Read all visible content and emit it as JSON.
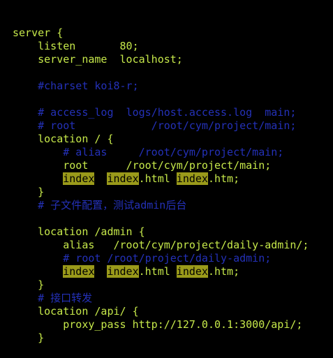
{
  "editor": {
    "lines": [
      {
        "parts": [
          {
            "text": "server {",
            "style": "t"
          }
        ]
      },
      {
        "parts": [
          {
            "text": "    listen       80;",
            "style": "t"
          }
        ]
      },
      {
        "parts": [
          {
            "text": "    server_name  localhost;",
            "style": "t"
          }
        ]
      },
      {
        "parts": []
      },
      {
        "parts": [
          {
            "text": "    #charset koi8-r;",
            "style": "c"
          }
        ]
      },
      {
        "parts": []
      },
      {
        "parts": [
          {
            "text": "    # access_log  logs/host.access.log  main;",
            "style": "c"
          }
        ]
      },
      {
        "parts": [
          {
            "text": "    # root            /root/cym/project/main;",
            "style": "c"
          }
        ]
      },
      {
        "parts": [
          {
            "text": "    location / {",
            "style": "t"
          }
        ]
      },
      {
        "parts": [
          {
            "text": "        # alias     /root/cym/project/main;",
            "style": "c"
          }
        ]
      },
      {
        "parts": [
          {
            "text": "        root      /root/cym/project/main;",
            "style": "t"
          }
        ]
      },
      {
        "parts": [
          {
            "text": "        ",
            "style": "t"
          },
          {
            "text": "index",
            "style": "hl"
          },
          {
            "text": "  ",
            "style": "t"
          },
          {
            "text": "index",
            "style": "hl"
          },
          {
            "text": ".html ",
            "style": "t"
          },
          {
            "text": "index",
            "style": "hl"
          },
          {
            "text": ".htm;",
            "style": "t"
          }
        ]
      },
      {
        "parts": [
          {
            "text": "    }",
            "style": "t"
          }
        ]
      },
      {
        "parts": [
          {
            "text": "    # 子文件配置，测试admin后台",
            "style": "c"
          }
        ]
      },
      {
        "parts": []
      },
      {
        "parts": [
          {
            "text": "    location /admin {",
            "style": "t"
          }
        ]
      },
      {
        "parts": [
          {
            "text": "        alias   /root/cym/project/daily-admin/;",
            "style": "t"
          }
        ]
      },
      {
        "parts": [
          {
            "text": "        # root /root/project/daily-admin;",
            "style": "c"
          }
        ]
      },
      {
        "parts": [
          {
            "text": "        ",
            "style": "t"
          },
          {
            "text": "index",
            "style": "hl"
          },
          {
            "text": "  ",
            "style": "t"
          },
          {
            "text": "index",
            "style": "hl"
          },
          {
            "text": ".html ",
            "style": "t"
          },
          {
            "text": "index",
            "style": "hl"
          },
          {
            "text": ".htm;",
            "style": "t"
          }
        ]
      },
      {
        "parts": [
          {
            "text": "    }",
            "style": "t"
          }
        ]
      },
      {
        "parts": [
          {
            "text": "    # 接口转发",
            "style": "c"
          }
        ]
      },
      {
        "parts": [
          {
            "text": "    location /api/ {",
            "style": "t"
          }
        ]
      },
      {
        "parts": [
          {
            "text": "        proxy_pass http://127.0.0.1:3000/api/;",
            "style": "t"
          }
        ]
      },
      {
        "parts": [
          {
            "text": "    }",
            "style": "t"
          }
        ]
      }
    ]
  }
}
